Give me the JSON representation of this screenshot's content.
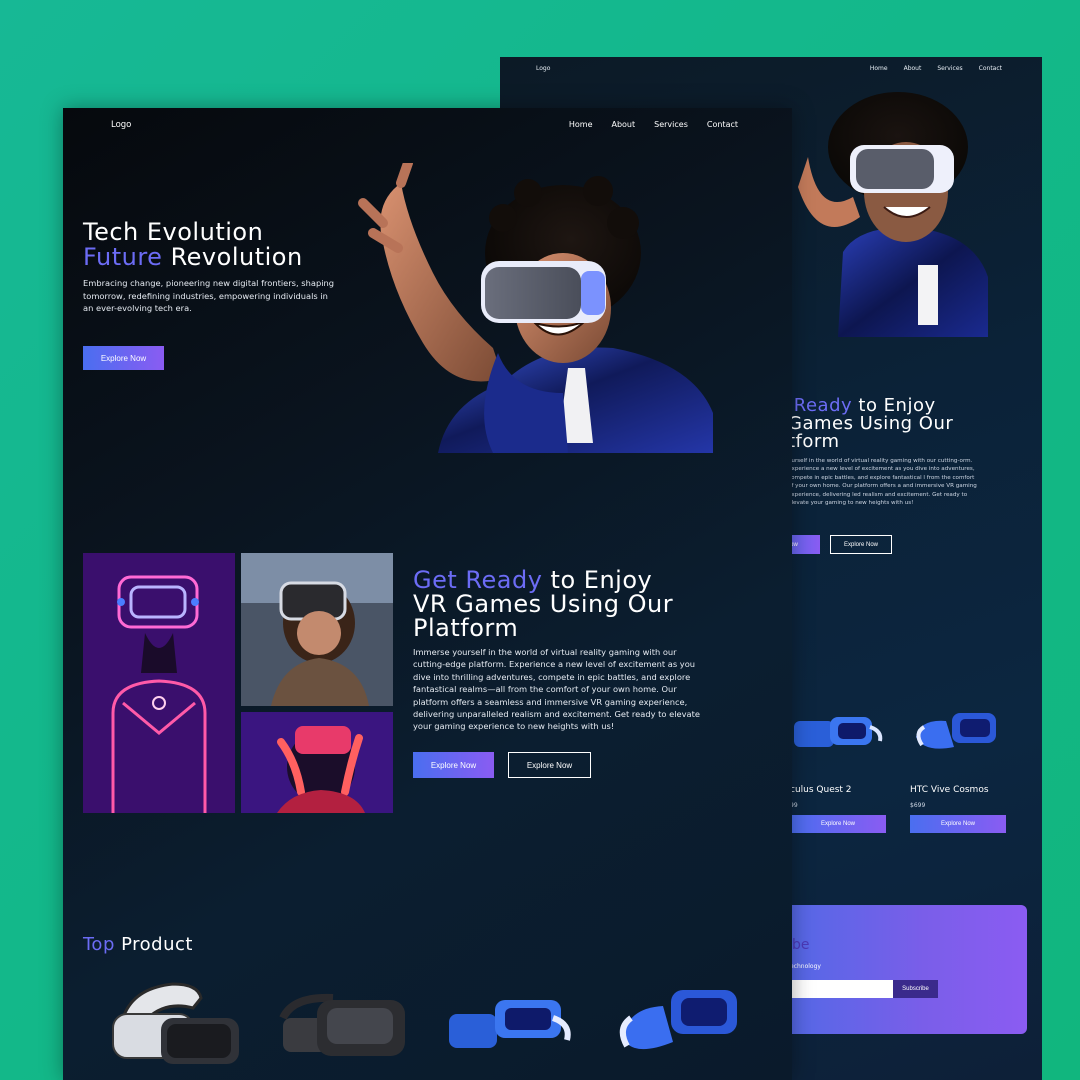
{
  "back_page": {
    "nav": {
      "logo": "Logo",
      "links": [
        "Home",
        "About",
        "Services",
        "Contact"
      ]
    },
    "headline": {
      "accent": "t Ready",
      "line1_rest": " to Enjoy",
      "line2": "Games Using Our",
      "line3": "tform"
    },
    "paragraph": "ourself in the world of virtual reality gaming with our cutting-orm. Experience a new level of excitement as you dive into adventures, compete in epic battles, and explore fantastical l from the comfort of your own home. Our platform offers a and immersive VR gaming experience, delivering led realism and excitement. Get ready to elevate your gaming to new heights with us!",
    "button_primary": "ow",
    "button_secondary": "Explore Now",
    "products": [
      {
        "name": "culus Quest 2",
        "price": "99",
        "button": "Explore Now"
      },
      {
        "name": "HTC Vive Cosmos",
        "price": "$699",
        "button": "Explore Now"
      }
    ],
    "subscribe": {
      "title": "be",
      "subtitle": "echnology",
      "input_placeholder": "",
      "button": "Subscribe",
      "title_color": "#4c3ab8"
    }
  },
  "front_page": {
    "nav": {
      "logo": "Logo",
      "links": [
        "Home",
        "About",
        "Services",
        "Contact"
      ]
    },
    "hero": {
      "title_line1": "Tech Evolution",
      "title_accent": "Future",
      "title_line2_rest": " Revolution",
      "text": "Embracing change, pioneering new digital frontiers, shaping tomorrow, redefining industries, empowering individuals in an ever-evolving tech era.",
      "button": "Explore Now"
    },
    "vr_section": {
      "title_accent": "Get Ready",
      "title_line1_rest": " to Enjoy",
      "title_line2": "VR Games Using Our",
      "title_line3": "Platform",
      "text": "Immerse yourself in the world of virtual reality gaming with our cutting-edge platform. Experience a new level of excitement as you dive into thrilling adventures, compete in epic battles, and explore fantastical realms—all from the comfort of your own home. Our platform offers a seamless and immersive VR gaming experience, delivering unparalleled realism and excitement. Get ready to elevate your gaming experience to new heights with us!",
      "button_primary": "Explore Now",
      "button_secondary": "Explore Now"
    },
    "top_product": {
      "accent": "Top",
      "rest": " Product"
    }
  },
  "colors": {
    "background": "#13b88a",
    "accent": "#6c6cf5",
    "button_gradient_start": "#4a6ef0",
    "button_gradient_end": "#8a5cf2",
    "page_dark": "#0a141f"
  },
  "icons": [
    "vr-headset-white",
    "vr-headset-black",
    "vr-headset-blue",
    "vr-headset-blue-2"
  ]
}
